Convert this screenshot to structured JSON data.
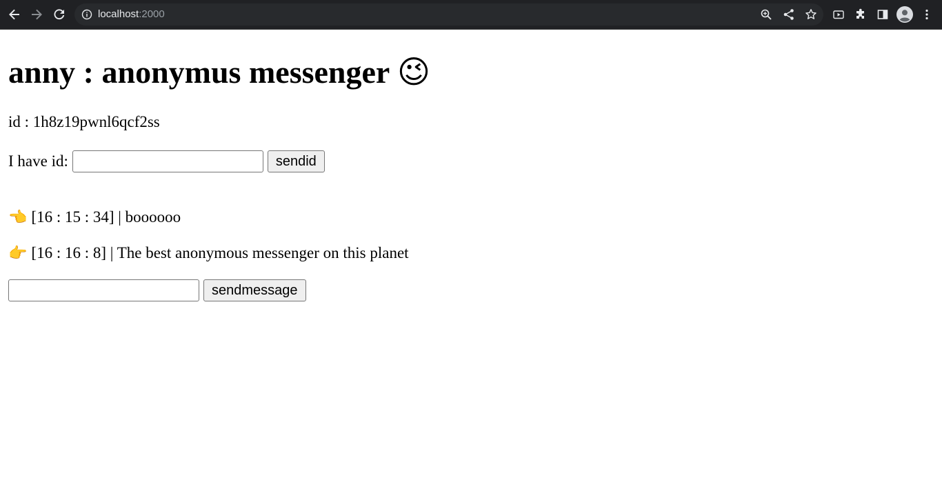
{
  "browser": {
    "url_host": "localhost",
    "url_port": ":2000"
  },
  "page": {
    "title": "anny : anonymus messenger",
    "title_emoji": "😉",
    "id_line": "id : 1h8z19pwnl6qcf2ss",
    "have_id_label": "I have id:",
    "have_id_input_value": "",
    "sendid_label": "sendid",
    "messages": [
      {
        "direction": "incoming",
        "icon": "👈",
        "text": "[16 : 15 : 34] | boooooo"
      },
      {
        "direction": "outgoing",
        "icon": "👉",
        "text": "[16 : 16 : 8] | The best anonymous messenger on this planet"
      }
    ],
    "message_input_value": "",
    "sendmessage_label": "sendmessage"
  }
}
